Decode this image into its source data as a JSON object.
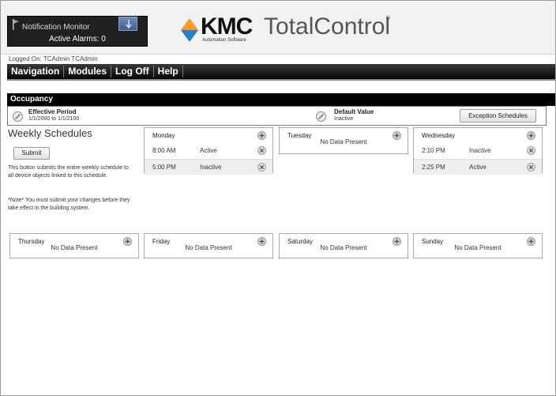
{
  "notification": {
    "title": "Notification Monitor",
    "alarms": "Active Alarms: 0"
  },
  "brand": {
    "kmc": "KMC",
    "totalcontrol": "TotalControl",
    "reg": "®",
    "subtitle": "Automation Software"
  },
  "session": {
    "logged_on": "Logged On: TCAdmin TCAdmin"
  },
  "menu": [
    "Navigation",
    "Modules",
    "Log Off",
    "Help"
  ],
  "page": {
    "section": "Occupancy",
    "effective_period_label": "Effective Period",
    "effective_period_value": "1/1/2000 to 1/1/2100",
    "default_value_label": "Default Value",
    "default_value": "Inactive",
    "exception_button": "Exception Schedules",
    "weekly_title": "Weekly Schedules",
    "submit_button": "Submit",
    "help_text": "This button submits the entire weekly schedule to all device objects linked to this schedule.",
    "note_text": "*Note* You must submit your changes before they take effect in the building system.",
    "no_data": "No Data Present"
  },
  "days": {
    "monday": {
      "name": "Monday",
      "entries": [
        {
          "time": "8:00 AM",
          "state": "Active"
        },
        {
          "time": "5:00 PM",
          "state": "Inactive"
        }
      ]
    },
    "tuesday": {
      "name": "Tuesday",
      "entries": []
    },
    "wednesday": {
      "name": "Wednesday",
      "entries": [
        {
          "time": "2:10 PM",
          "state": "Inactive"
        },
        {
          "time": "2:25 PM",
          "state": "Active"
        }
      ]
    },
    "thursday": {
      "name": "Thursday",
      "entries": []
    },
    "friday": {
      "name": "Friday",
      "entries": []
    },
    "saturday": {
      "name": "Saturday",
      "entries": []
    },
    "sunday": {
      "name": "Sunday",
      "entries": []
    }
  },
  "colors": {
    "menubar": "#111111",
    "section_bar": "#000000",
    "logo_orange": "#f39c2a",
    "logo_blue": "#2f7fc4"
  },
  "icons": {
    "add": "plus-circle-icon",
    "delete": "x-circle-icon",
    "period": "stop-sign-icon",
    "notification": "flag-icon"
  }
}
